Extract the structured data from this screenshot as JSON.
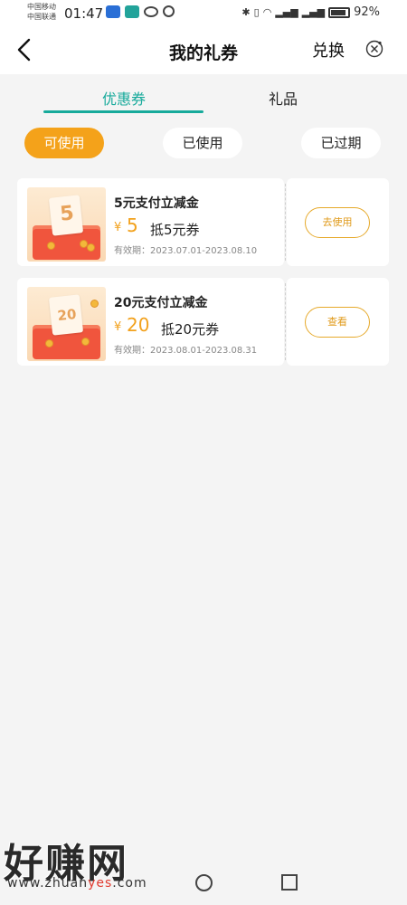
{
  "status_bar": {
    "carrier_1": "中国移动",
    "carrier_2": "中国联通",
    "time": "01:47",
    "battery": "92%"
  },
  "header": {
    "title": "我的礼券",
    "redeem": "兑换"
  },
  "tabs": [
    {
      "label": "优惠券"
    },
    {
      "label": "礼品"
    }
  ],
  "filters": [
    {
      "label": "可使用"
    },
    {
      "label": "已使用"
    },
    {
      "label": "已过期"
    }
  ],
  "coupons": [
    {
      "thumb_text": "5",
      "name": "5元支付立减金",
      "currency": "¥",
      "amount": "5",
      "desc": "抵5元券",
      "validity": "有效期：2023.07.01-2023.08.10",
      "action": "去使用"
    },
    {
      "thumb_text": "20",
      "name": "20元支付立减金",
      "currency": "¥",
      "amount": "20",
      "desc": "抵20元券",
      "validity": "有效期：2023.08.01-2023.08.31",
      "action": "查看"
    }
  ],
  "watermark": {
    "text": "好赚网",
    "url_pre": "www.zhuan",
    "url_hl": "yes",
    "url_post": ".com"
  },
  "colors": {
    "accent": "#17aa9b",
    "orange": "#f4a21a"
  }
}
